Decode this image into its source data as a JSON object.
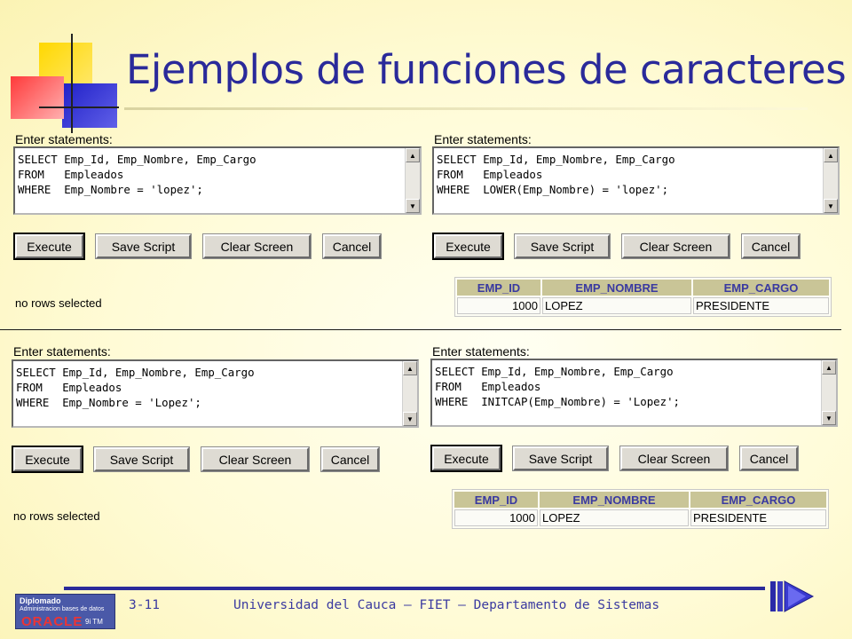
{
  "title": "Ejemplos de funciones de caracteres",
  "panels": [
    {
      "label": "Enter statements:",
      "code": "SELECT Emp_Id, Emp_Nombre, Emp_Cargo\nFROM   Empleados\nWHERE  Emp_Nombre = 'lopez';",
      "buttons": {
        "execute": "Execute",
        "save": "Save Script",
        "clear": "Clear Screen",
        "cancel": "Cancel"
      },
      "result_text": "no rows selected"
    },
    {
      "label": "Enter statements:",
      "code": "SELECT Emp_Id, Emp_Nombre, Emp_Cargo\nFROM   Empleados\nWHERE  LOWER(Emp_Nombre) = 'lopez';",
      "buttons": {
        "execute": "Execute",
        "save": "Save Script",
        "clear": "Clear Screen",
        "cancel": "Cancel"
      },
      "result_table": {
        "headers": [
          "EMP_ID",
          "EMP_NOMBRE",
          "EMP_CARGO"
        ],
        "rows": [
          [
            "1000",
            "LOPEZ",
            "PRESIDENTE"
          ]
        ]
      }
    },
    {
      "label": "Enter statements:",
      "code": "SELECT Emp_Id, Emp_Nombre, Emp_Cargo\nFROM   Empleados\nWHERE  Emp_Nombre = 'Lopez';",
      "buttons": {
        "execute": "Execute",
        "save": "Save Script",
        "clear": "Clear Screen",
        "cancel": "Cancel"
      },
      "result_text": "no rows selected"
    },
    {
      "label": "Enter statements:",
      "code": "SELECT Emp_Id, Emp_Nombre, Emp_Cargo\nFROM   Empleados\nWHERE  INITCAP(Emp_Nombre) = 'Lopez';",
      "buttons": {
        "execute": "Execute",
        "save": "Save Script",
        "clear": "Clear Screen",
        "cancel": "Cancel"
      },
      "result_table": {
        "headers": [
          "EMP_ID",
          "EMP_NOMBRE",
          "EMP_CARGO"
        ],
        "rows": [
          [
            "1000",
            "LOPEZ",
            "PRESIDENTE"
          ]
        ]
      }
    }
  ],
  "footer": {
    "page": "3-11",
    "text": "Universidad del Cauca – FIET – Departamento de Sistemas",
    "badge_line1": "Diplomado",
    "badge_line2": "Administracion bases de datos",
    "badge_brand": "ORACLE",
    "badge_version": "9i TM"
  },
  "colors": {
    "title": "#2a2a9a",
    "accent_blue": "#2a2a9a",
    "header_bg": "#c9c597"
  }
}
